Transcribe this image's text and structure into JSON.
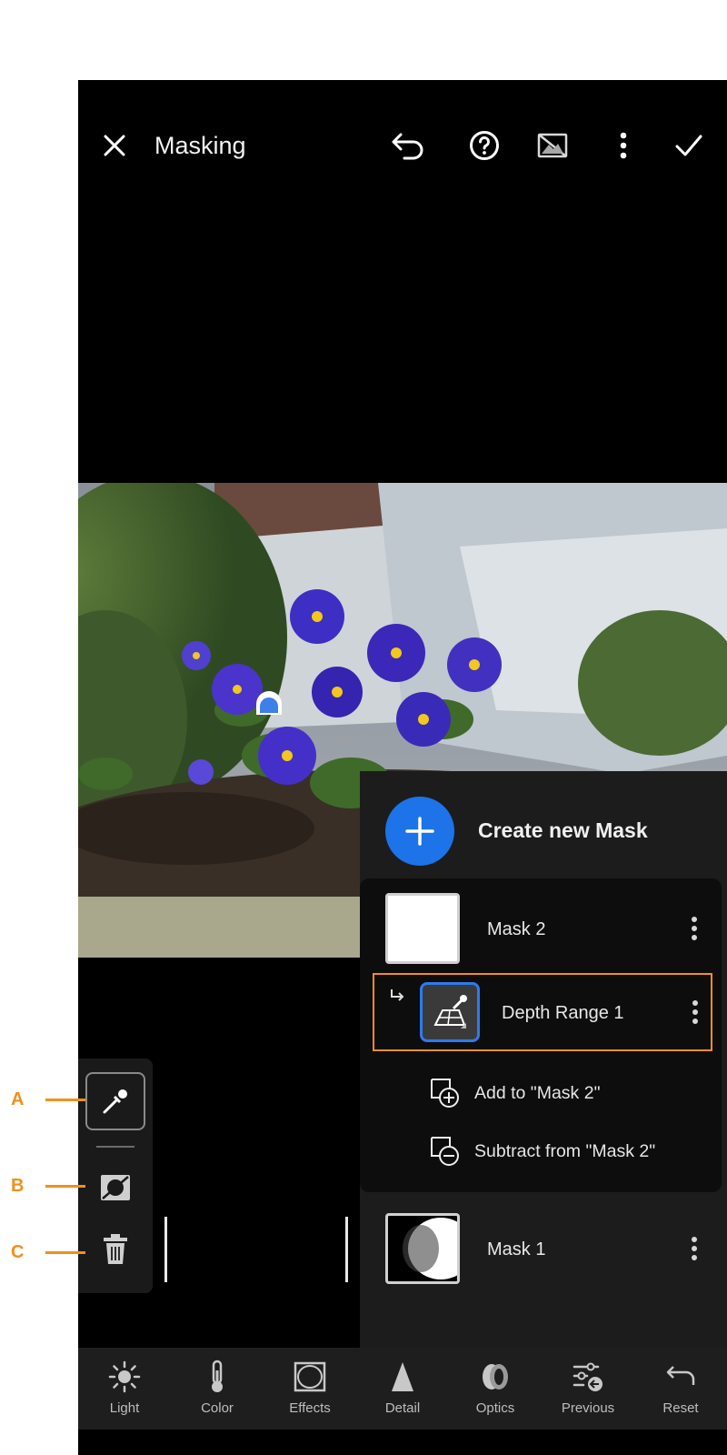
{
  "header": {
    "title": "Masking",
    "icons": [
      "close-icon",
      "undo-icon",
      "help-icon",
      "overlay-toggle-icon",
      "more-vert-icon",
      "check-icon"
    ]
  },
  "panel": {
    "create_label": "Create new Mask",
    "masks": [
      {
        "name": "Mask 2",
        "component": "Depth Range 1",
        "actions": [
          "Add to \"Mask 2\"",
          "Subtract from \"Mask 2\""
        ]
      },
      {
        "name": "Mask 1"
      }
    ]
  },
  "tools": {
    "callouts": [
      "A",
      "B",
      "C"
    ],
    "icons": [
      "eyedropper-icon",
      "invert-mask-icon",
      "trash-icon"
    ]
  },
  "toolbar": {
    "items": [
      {
        "label": "Light",
        "icon": "sun-icon"
      },
      {
        "label": "Color",
        "icon": "thermometer-icon"
      },
      {
        "label": "Effects",
        "icon": "vignette-icon"
      },
      {
        "label": "Detail",
        "icon": "triangle-icon"
      },
      {
        "label": "Optics",
        "icon": "lens-icon"
      },
      {
        "label": "Previous",
        "icon": "previous-settings-icon"
      },
      {
        "label": "Reset",
        "icon": "reset-icon"
      }
    ]
  },
  "colors": {
    "accent": "#1d73e8",
    "highlight": "#f0901e",
    "background": "#000000"
  }
}
